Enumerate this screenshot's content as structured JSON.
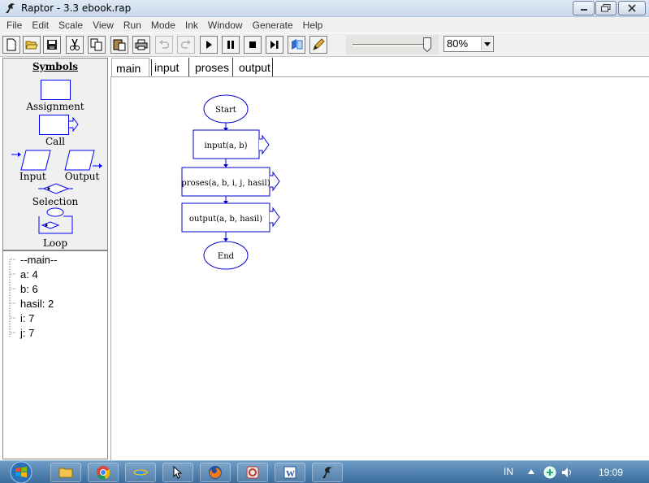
{
  "window": {
    "title": "Raptor - 3.3 ebook.rap"
  },
  "menu": [
    "File",
    "Edit",
    "Scale",
    "View",
    "Run",
    "Mode",
    "Ink",
    "Window",
    "Generate",
    "Help"
  ],
  "toolbar": {
    "zoom_value": "80%",
    "speed_level": 1.0
  },
  "symbols": {
    "title": "Symbols",
    "assignment": "Assignment",
    "call": "Call",
    "input": "Input",
    "output": "Output",
    "selection": "Selection",
    "loop": "Loop"
  },
  "variables": {
    "root": "--main--",
    "items": [
      "a: 4",
      "b: 6",
      "hasil: 2",
      "i: 7",
      "j: 7"
    ]
  },
  "tabs": [
    "main",
    "input",
    "proses",
    "output"
  ],
  "flowchart": {
    "start": "Start",
    "step1": "input(a, b)",
    "step2": "proses(a, b, i, j, hasil)",
    "step3": "output(a, b, hasil)",
    "end": "End"
  },
  "taskbar": {
    "lang": "IN",
    "clock": "19:09"
  },
  "colors": {
    "flow_blue": "#0000cc",
    "symbol_blue": "#0000ff"
  }
}
